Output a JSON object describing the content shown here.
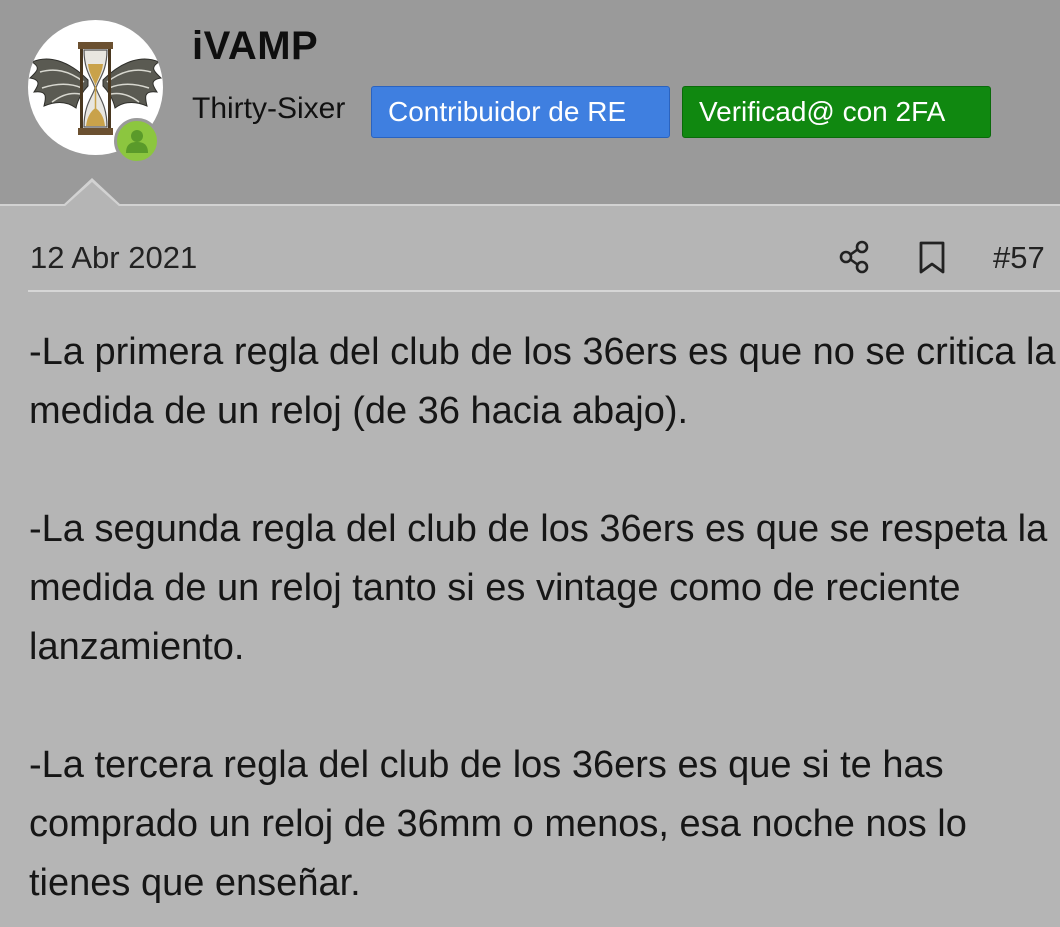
{
  "user": {
    "name": "iVAMP",
    "title": "Thirty-Sixer",
    "avatar_icon": "hourglass-wings-icon",
    "online_icon": "user-online-icon",
    "badges": [
      {
        "label": "Contribuidor de RE",
        "color": "#3f7fe0"
      },
      {
        "label": "Verificad@ con 2FA",
        "color": "#108810"
      }
    ]
  },
  "post": {
    "date": "12 Abr 2021",
    "number": "#57",
    "actions": [
      {
        "icon": "share-icon"
      },
      {
        "icon": "bookmark-icon"
      }
    ],
    "paragraphs": [
      "-La primera regla del club de los 36ers es que no se critica la medida de un reloj (de 36 hacia abajo).",
      "-La segunda regla del club de los 36ers es que se respeta la medida de un reloj tanto si es vintage como de reciente lanzamiento.",
      "-La tercera regla del club de los 36ers es que si te has comprado un reloj de 36mm o menos, esa noche nos lo tienes que enseñar."
    ]
  }
}
